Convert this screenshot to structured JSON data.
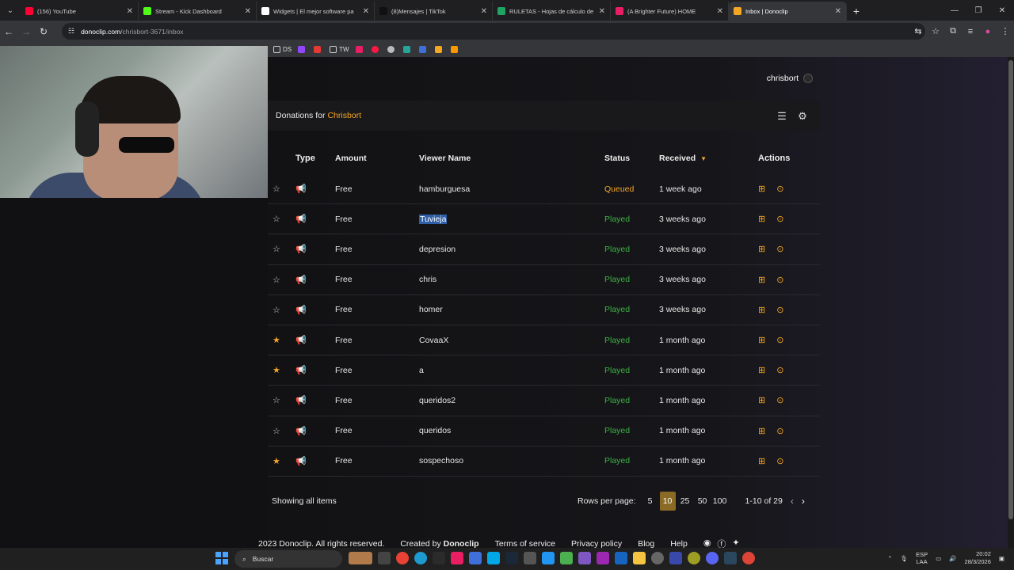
{
  "browser": {
    "tabs": [
      {
        "title": "(156) YouTube",
        "color": "#ff0033"
      },
      {
        "title": "Stream - Kick Dashboard",
        "color": "#53fc18"
      },
      {
        "title": "Widgets | El mejor software pa",
        "color": "#ffffff"
      },
      {
        "title": "(8)Mensajes | TikTok",
        "color": "#111111"
      },
      {
        "title": "RULETAS - Hojas de cálculo de",
        "color": "#1fa463"
      },
      {
        "title": "(A Brighter Future) HOME",
        "color": "#e91e63"
      },
      {
        "title": "Inbox | Donoclip",
        "color": "#f5a623",
        "active": true
      }
    ],
    "url_domain": "donoclip.com",
    "url_path": "/chrisbort-3671/inbox",
    "bookmarks": [
      "DS",
      "TW"
    ]
  },
  "app": {
    "username": "chrisbort",
    "donations_label": "Donations for",
    "channel": "Chrisbort",
    "columns": {
      "type": "Type",
      "amount": "Amount",
      "viewer": "Viewer Name",
      "status": "Status",
      "received": "Received",
      "actions": "Actions"
    },
    "rows": [
      {
        "starred": false,
        "amount": "Free",
        "viewer": "hamburguesa",
        "status": "Queued",
        "received": "1 week ago"
      },
      {
        "starred": false,
        "amount": "Free",
        "viewer": "Tuvieja",
        "status": "Played",
        "received": "3 weeks ago",
        "selected": true
      },
      {
        "starred": false,
        "amount": "Free",
        "viewer": "depresion",
        "status": "Played",
        "received": "3 weeks ago"
      },
      {
        "starred": false,
        "amount": "Free",
        "viewer": "chris",
        "status": "Played",
        "received": "3 weeks ago"
      },
      {
        "starred": false,
        "amount": "Free",
        "viewer": "homer",
        "status": "Played",
        "received": "3 weeks ago"
      },
      {
        "starred": true,
        "amount": "Free",
        "viewer": "CovaaX",
        "status": "Played",
        "received": "1 month ago"
      },
      {
        "starred": true,
        "amount": "Free",
        "viewer": "a",
        "status": "Played",
        "received": "1 month ago"
      },
      {
        "starred": false,
        "amount": "Free",
        "viewer": "queridos2",
        "status": "Played",
        "received": "1 month ago"
      },
      {
        "starred": false,
        "amount": "Free",
        "viewer": "queridos",
        "status": "Played",
        "received": "1 month ago"
      },
      {
        "starred": true,
        "amount": "Free",
        "viewer": "sospechoso",
        "status": "Played",
        "received": "1 month ago"
      }
    ],
    "showing": "Showing all items",
    "rows_per_page_label": "Rows per page:",
    "rows_per_page_options": [
      "5",
      "10",
      "25",
      "50",
      "100"
    ],
    "rows_per_page_selected": "10",
    "range": "1-10 of 29",
    "footer": {
      "copyright": "2023 Donoclip. All rights reserved.",
      "created_by_label": "Created by",
      "created_by": "Donoclip",
      "terms": "Terms of service",
      "privacy": "Privacy policy",
      "blog": "Blog",
      "help": "Help"
    },
    "colors": {
      "accent": "#f5a623",
      "played": "#3cb043"
    }
  },
  "taskbar": {
    "search_placeholder": "Buscar",
    "lang_top": "ESP",
    "lang_bottom": "LAA",
    "time": "20:02",
    "date": "28/3/2026"
  }
}
